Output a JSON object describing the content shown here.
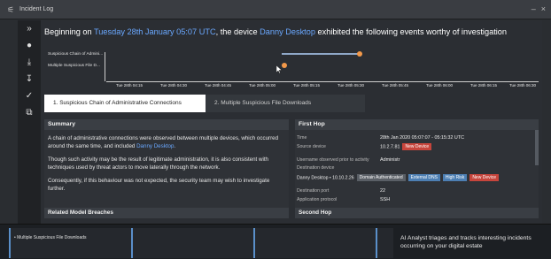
{
  "window": {
    "title": "Incident Log",
    "minimize": "–",
    "close": "×"
  },
  "sidebar": {
    "items": [
      {
        "icon": "chevrons-down-icon",
        "glyph": "»"
      },
      {
        "icon": "chat-icon",
        "glyph": "●"
      },
      {
        "icon": "download-icon",
        "glyph": "⤓"
      },
      {
        "icon": "pin-icon",
        "glyph": "↧"
      },
      {
        "icon": "check-icon",
        "glyph": "✓"
      },
      {
        "icon": "copy-icon",
        "glyph": "⧉"
      }
    ]
  },
  "headline": {
    "prefix": "Beginning on ",
    "date": "Tuesday 28th January 05:07 UTC",
    "middle": ", the device ",
    "device": "Danny Desktop",
    "suffix": " exhibited the following events worthy of investigation"
  },
  "timeline": {
    "rows": [
      "Suspicious Chain of Admini...",
      "Multiple Suspicious File D..."
    ],
    "ticks": [
      "Tue 28th 04:15",
      "Tue 28th 04:30",
      "Tue 28th 04:45",
      "Tue 28th 05:00",
      "Tue 28th 05:15",
      "Tue 28th 05:30",
      "Tue 28th 05:45",
      "Tue 28th 06:00",
      "Tue 28th 06:15",
      "Tue 28th 06:30"
    ]
  },
  "tabs": [
    {
      "label": "1. Suspicious Chain of Administrative Connections"
    },
    {
      "label": "2. Multiple Suspicious File Downloads"
    }
  ],
  "summary": {
    "header": "Summary",
    "p1_prefix": "A chain of administrative connections were observed between multiple devices, which occurred around the same time, and included ",
    "p1_link": "Danny Desktop",
    "p1_suffix": ".",
    "p2": "Though such activity may be the result of legitimate administration, it is also consistent with techniques used by threat actors to move laterally through the network.",
    "p3": "Consequently, if this behaviour was not expected, the security team may wish to investigate further."
  },
  "related": {
    "header": "Related Model Breaches"
  },
  "first_hop": {
    "header": "First Hop",
    "time_label": "Time",
    "time_value": "28th Jan 2020 05:07:07 - 05:15:32 UTC",
    "source_label": "Source device",
    "source_value": "10.2.7.81",
    "source_badge": "New Device",
    "user_label": "Username observed prior to activity",
    "user_value": "Administr",
    "dest_label": "Destination device",
    "dest_value": "Danny Desktop • 10.10.2.26",
    "dest_badges": [
      "Domain Authenticated",
      "External DNS",
      "High Risk",
      "New Device"
    ],
    "port_label": "Destination port",
    "port_value": "22",
    "proto_label": "Application protocol",
    "proto_value": "SSH"
  },
  "second_hop": {
    "header": "Second Hop"
  },
  "bottom": {
    "item": "Multiple Suspicious File Downloads",
    "note": "AI Analyst triages and tracks interesting incidents occurring on your digital estate"
  },
  "colors": {
    "accent": "#6aa8ff",
    "orange": "#f2994a",
    "red": "#c7453c",
    "blue_badge": "#4d7fb3"
  }
}
